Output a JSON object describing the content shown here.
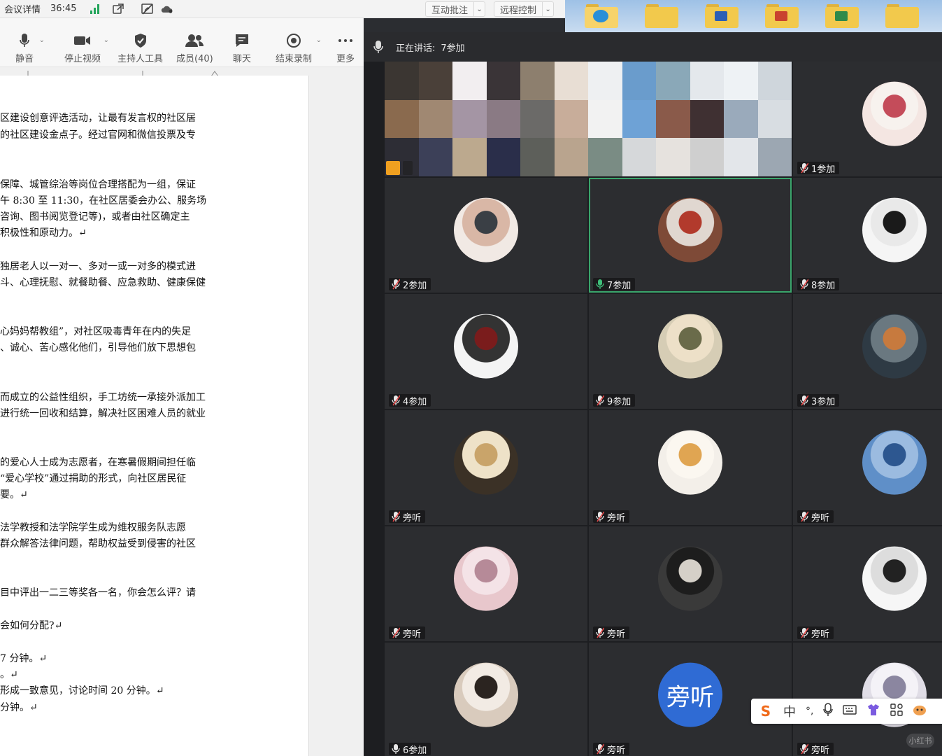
{
  "meeting": {
    "details_label": "会议详情",
    "timer": "36:45",
    "annotate_label": "互动批注",
    "remote_label": "远程控制"
  },
  "toolbar": {
    "mute": "静音",
    "stop_video": "停止视频",
    "host_tools": "主持人工具",
    "members": "成员(40)",
    "chat": "聊天",
    "end_record": "结束录制",
    "more": "更多"
  },
  "document": {
    "lines": [
      "区建设创意评选活动，让最有发言权的社区居",
      "的社区建设金点子。经过官网和微信投票及专",
      "保障、城管综治等岗位合理搭配为一组，保证",
      "午 8:30 至 11:30，在社区居委会办公、服务场",
      "咨询、图书阅览登记等)，或者由社区确定主",
      "积极性和原动力。↵",
      "独居老人以一对一、多对一或一对多的模式进",
      "斗、心理抚慰、就餐助餐、应急救助、健康保健",
      "心妈妈帮教组”，对社区吸毒青年在内的失足",
      "、诚心、苦心感化他们，引导他们放下思想包",
      "而成立的公益性组织，手工坊统一承接外派加工",
      "进行统一回收和结算，解决社区困难人员的就业",
      "的爱心人士成为志愿者，在寒暑假期间担任临",
      "“爱心学校”通过捐助的形式，向社区居民征",
      "要。↵",
      "法学教授和法学院学生成为维权服务队志愿",
      "群众解答法律问题，帮助权益受到侵害的社区",
      "目中评出一二三等奖各一名，你会怎么评？请",
      "会如何分配?↵",
      "7 分钟。↵",
      "。↵",
      "形成一致意见，讨论时间 20 分钟。↵",
      "分钟。↵"
    ]
  },
  "video": {
    "speaking_label": "正在讲话:",
    "speaking_name": "7参加",
    "tiles": [
      {
        "name": "1参加",
        "mic": "muted"
      },
      {
        "name": "2参加",
        "mic": "muted"
      },
      {
        "name": "7参加",
        "mic": "active"
      },
      {
        "name": "8参加",
        "mic": "muted"
      },
      {
        "name": "4参加",
        "mic": "muted"
      },
      {
        "name": "9参加",
        "mic": "muted"
      },
      {
        "name": "3参加",
        "mic": "muted"
      },
      {
        "name": "旁听",
        "mic": "muted"
      },
      {
        "name": "旁听",
        "mic": "muted"
      },
      {
        "name": "旁听",
        "mic": "muted"
      },
      {
        "name": "旁听",
        "mic": "muted"
      },
      {
        "name": "旁听",
        "mic": "muted"
      },
      {
        "name": "旁听",
        "mic": "muted"
      },
      {
        "name": "6参加",
        "mic": "on"
      },
      {
        "name": "旁听",
        "mic": "muted"
      },
      {
        "name": "旁听",
        "mic": "muted"
      }
    ],
    "text_avatar": "旁听"
  },
  "ime": {
    "logo": "S",
    "mode": "中",
    "punct": "°,"
  },
  "watermark": "小红书",
  "colors": {
    "active_border": "#3aa56b",
    "signal": "#22a45a",
    "text_avatar_bg": "#2f6bd4"
  }
}
